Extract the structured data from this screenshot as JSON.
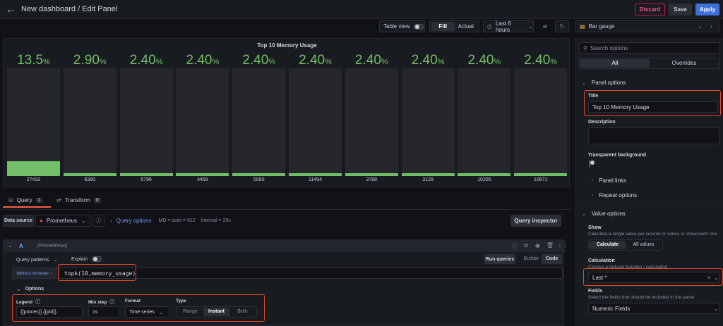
{
  "header": {
    "title": "New dashboard / Edit Panel",
    "discard_label": "Discard",
    "save_label": "Save",
    "apply_label": "Apply"
  },
  "toolbar": {
    "table_view_label": "Table view",
    "fill_label": "Fill",
    "actual_label": "Actual",
    "time_range": "Last 6 hours"
  },
  "viz_picker": {
    "label": "Bar gauge"
  },
  "panel": {
    "title": "Top 10 Memory Usage",
    "bar_color": "#73bf69",
    "bars": [
      {
        "pct": "13.5",
        "value": "27432",
        "fill": 0.135
      },
      {
        "pct": "2.90",
        "value": "6390",
        "fill": 0.029
      },
      {
        "pct": "2.40",
        "value": "5796",
        "fill": 0.024
      },
      {
        "pct": "2.40",
        "value": "4458",
        "fill": 0.024
      },
      {
        "pct": "2.40",
        "value": "5080",
        "fill": 0.024
      },
      {
        "pct": "2.40",
        "value": "11494",
        "fill": 0.024
      },
      {
        "pct": "2.40",
        "value": "3788",
        "fill": 0.024
      },
      {
        "pct": "2.40",
        "value": "3129",
        "fill": 0.024
      },
      {
        "pct": "2.40",
        "value": "10255",
        "fill": 0.024
      },
      {
        "pct": "2.40",
        "value": "10871",
        "fill": 0.024
      }
    ],
    "pct_unit": "%"
  },
  "tabs": {
    "query_label": "Query",
    "query_count": "1",
    "transform_label": "Transform",
    "transform_count": "0"
  },
  "datasource": {
    "label": "Data source",
    "selected": "Prometheus",
    "query_options_label": "Query options",
    "md_text": "MD = auto = 912",
    "interval_text": "Interval = 20s",
    "inspector_label": "Query inspector"
  },
  "query": {
    "ref_id": "A",
    "ds_name": "(Prometheus)",
    "query_patterns_label": "Query patterns",
    "explain_label": "Explain",
    "run_queries_label": "Run queries",
    "builder_label": "Builder",
    "code_label": "Code",
    "metrics_browser_label": "Metrics browser",
    "expr": "topk(10,memory_usage)",
    "options_label": "Options",
    "legend_label": "Legend",
    "legend_value": "{{proces}} {{pid}}",
    "min_step_label": "Min step",
    "min_step_value": "1s",
    "format_label": "Format",
    "format_value": "Time series",
    "type_label": "Type",
    "type_range": "Range",
    "type_instant": "Instant",
    "type_both": "Both"
  },
  "options_pane": {
    "search_placeholder": "Search options",
    "tab_all": "All",
    "tab_overrides": "Overrides",
    "panel_options_label": "Panel options",
    "title_label": "Title",
    "title_value": "Top 10 Memory Usage",
    "description_label": "Description",
    "transparent_label": "Transparent background",
    "panel_links_label": "Panel links",
    "repeat_options_label": "Repeat options",
    "value_options_label": "Value options",
    "show_label": "Show",
    "show_desc": "Calculate a single value per column or series or show each row",
    "calculate_label": "Calculate",
    "all_values_label": "All values",
    "calculation_label": "Calculation",
    "calculation_desc": "Choose a reducer function / calculation",
    "calculation_value": "Last *",
    "fields_label": "Fields",
    "fields_desc": "Select the fields that should be included in the panel",
    "fields_value": "Numeric Fields"
  },
  "colors": {
    "accent_red": "#e0482c",
    "apply_blue": "#3d71d9",
    "link_blue": "#6e9fff"
  }
}
